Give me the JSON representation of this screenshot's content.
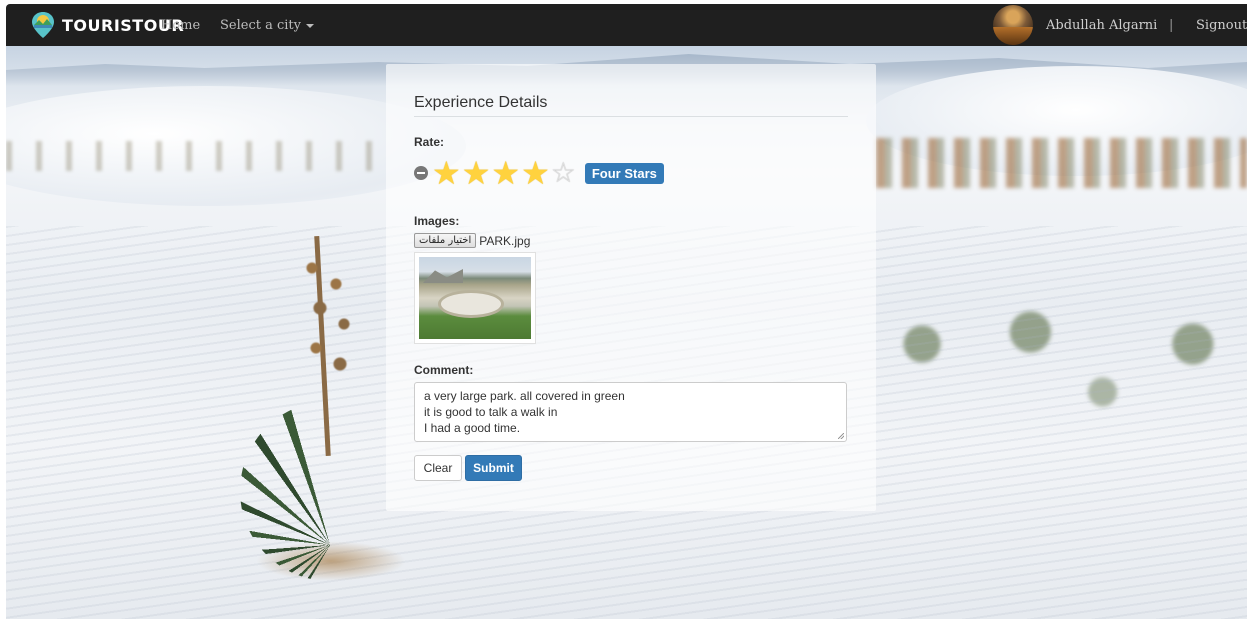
{
  "navbar": {
    "brand": "TOURISTOUR",
    "home": "Home",
    "select_city": "Select a city",
    "user_name": "Abdullah Algarni",
    "separator": "|",
    "signout": "Signout"
  },
  "form": {
    "title": "Experience Details",
    "rate_label": "Rate:",
    "rating": {
      "value": 4,
      "max": 5,
      "caption": "Four Stars"
    },
    "images_label": "Images:",
    "file_button": "اختيار ملفات",
    "file_name": "PARK.jpg",
    "comment_label": "Comment:",
    "comment_lines": [
      "a very large park. all covered in green",
      "it is good to talk a walk in",
      "I had a good time."
    ],
    "clear_button": "Clear",
    "submit_button": "Submit"
  },
  "icons": {
    "logo": "map-pin-logo-icon",
    "star": "star-icon",
    "clear_rating": "minus-circle-icon",
    "caret": "caret-down-icon"
  },
  "colors": {
    "navbar_bg": "#1f1f1f",
    "primary": "#337ab7",
    "star_filled": "#ffd23e",
    "star_empty": "#e2e2e2"
  }
}
